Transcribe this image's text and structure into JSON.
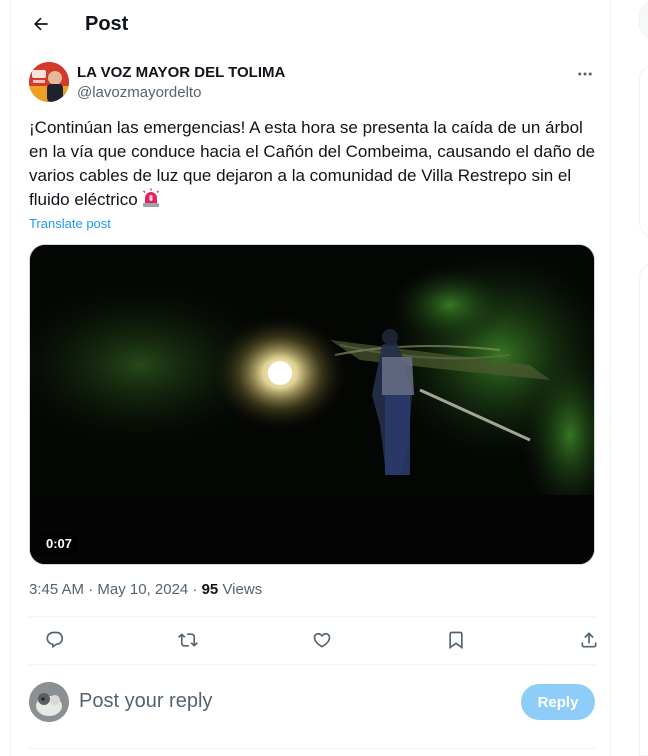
{
  "header": {
    "title": "Post"
  },
  "post": {
    "author_name": "LA VOZ MAYOR DEL TOLIMA",
    "author_handle": "@lavozmayordelto",
    "text": "¡Continúan las emergencias! A esta hora se presenta la caída de un árbol en la vía que conduce hacia el Cañón del Combeima, causando el daño de varios cables de luz que dejaron a la comunidad de Villa Restrepo sin el fluido eléctrico",
    "emoji": "siren-icon",
    "translate_label": "Translate post",
    "video_duration": "0:07",
    "timestamp": "3:45 AM · May 10, 2024 · ",
    "views_count": "95",
    "views_label": " Views"
  },
  "actions": {
    "icons": [
      "reply-icon",
      "repost-icon",
      "like-icon",
      "bookmark-icon",
      "share-icon"
    ]
  },
  "reply": {
    "placeholder": "Post your reply",
    "button_label": "Reply"
  },
  "colors": {
    "accent": "#1d9bf0",
    "reply_button": "#8ecdf7",
    "secondary_text": "#536471",
    "siren": "#e0245e"
  }
}
